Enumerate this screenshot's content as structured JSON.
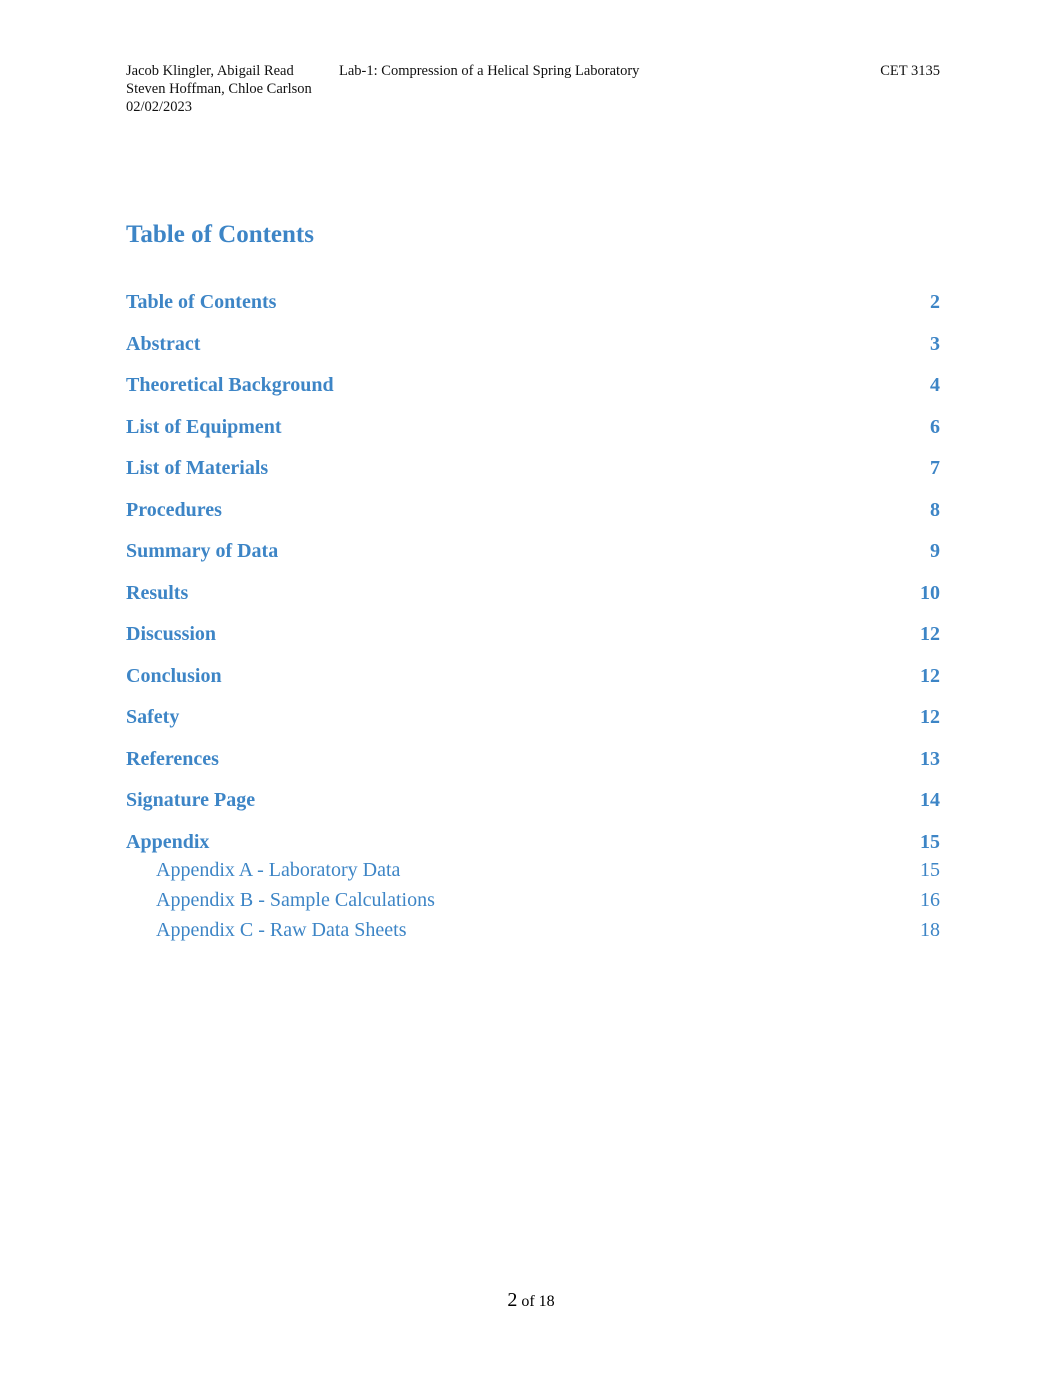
{
  "header": {
    "authors_line1": "Jacob Klingler, Abigail Read",
    "authors_line2": "Steven Hoffman, Chloe Carlson",
    "date": "02/02/2023",
    "lab_title": "Lab-1: Compression of a Helical Spring Laboratory",
    "course": "CET 3135"
  },
  "toc": {
    "title": "Table of Contents",
    "entries": [
      {
        "label": "Table of Contents",
        "page": "2"
      },
      {
        "label": "Abstract",
        "page": "3"
      },
      {
        "label": "Theoretical Background",
        "page": "4"
      },
      {
        "label": "List of Equipment",
        "page": "6"
      },
      {
        "label": "List of Materials",
        "page": "7"
      },
      {
        "label": "Procedures",
        "page": "8"
      },
      {
        "label": "Summary of Data",
        "page": "9"
      },
      {
        "label": "Results",
        "page": "10"
      },
      {
        "label": "Discussion",
        "page": "12"
      },
      {
        "label": "Conclusion",
        "page": "12"
      },
      {
        "label": "Safety",
        "page": "12"
      },
      {
        "label": "References",
        "page": "13"
      },
      {
        "label": "Signature Page",
        "page": "14"
      },
      {
        "label": "Appendix",
        "page": "15"
      }
    ],
    "sub_entries": [
      {
        "label": "Appendix A - Laboratory Data",
        "page": "15"
      },
      {
        "label": "Appendix B - Sample Calculations",
        "page": "16"
      },
      {
        "label": "Appendix C - Raw Data Sheets",
        "page": "18"
      }
    ]
  },
  "footer": {
    "page_number": "2",
    "of_total": "of 18"
  },
  "colors": {
    "heading_blue": "#3d85c6"
  }
}
